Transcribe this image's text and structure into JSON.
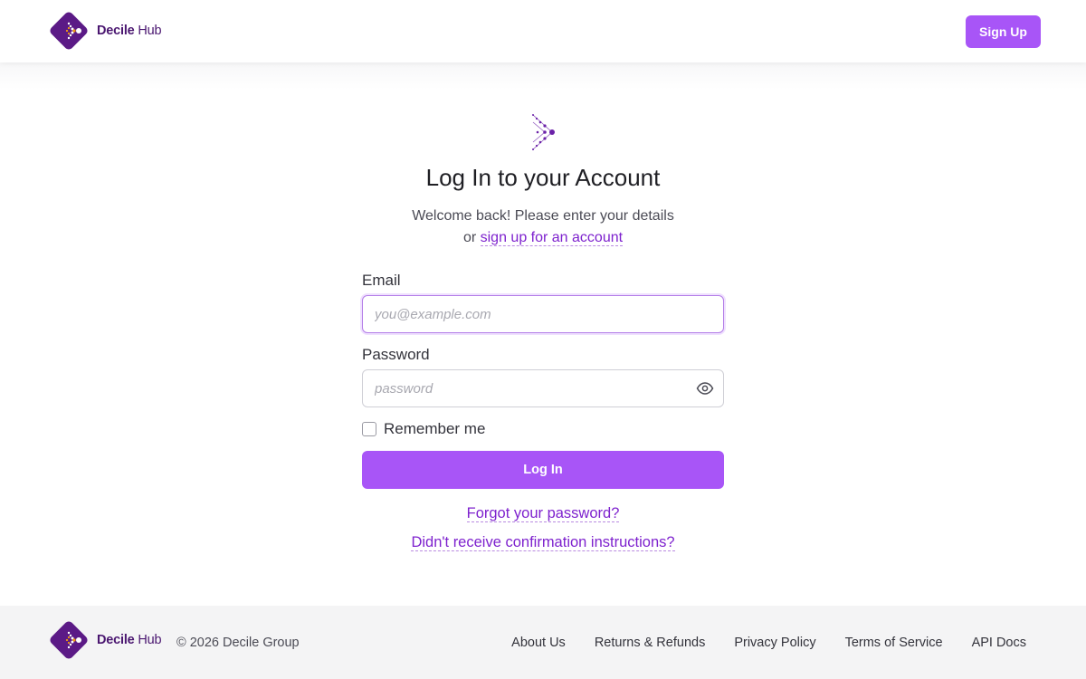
{
  "colors": {
    "accent": "#a855f7",
    "link": "#7e22ce",
    "brand_dark": "#4a1670"
  },
  "header": {
    "brand_name": "Decile",
    "brand_suffix": "Hub",
    "signup_label": "Sign Up"
  },
  "login": {
    "title": "Log In to your Account",
    "subtitle_line1": "Welcome back! Please enter your details",
    "subtitle_or": "or",
    "signup_link": "sign up for an account",
    "email_label": "Email",
    "email_placeholder": "you@example.com",
    "email_value": "",
    "password_label": "Password",
    "password_placeholder": "password",
    "password_value": "",
    "remember_label": "Remember me",
    "login_button": "Log In",
    "forgot_link": "Forgot your password?",
    "confirm_link": "Didn't receive confirmation instructions?"
  },
  "footer": {
    "brand_name": "Decile",
    "brand_suffix": "Hub",
    "copyright": "© 2026 Decile Group",
    "links": [
      "About Us",
      "Returns & Refunds",
      "Privacy Policy",
      "Terms of Service",
      "API Docs"
    ]
  }
}
